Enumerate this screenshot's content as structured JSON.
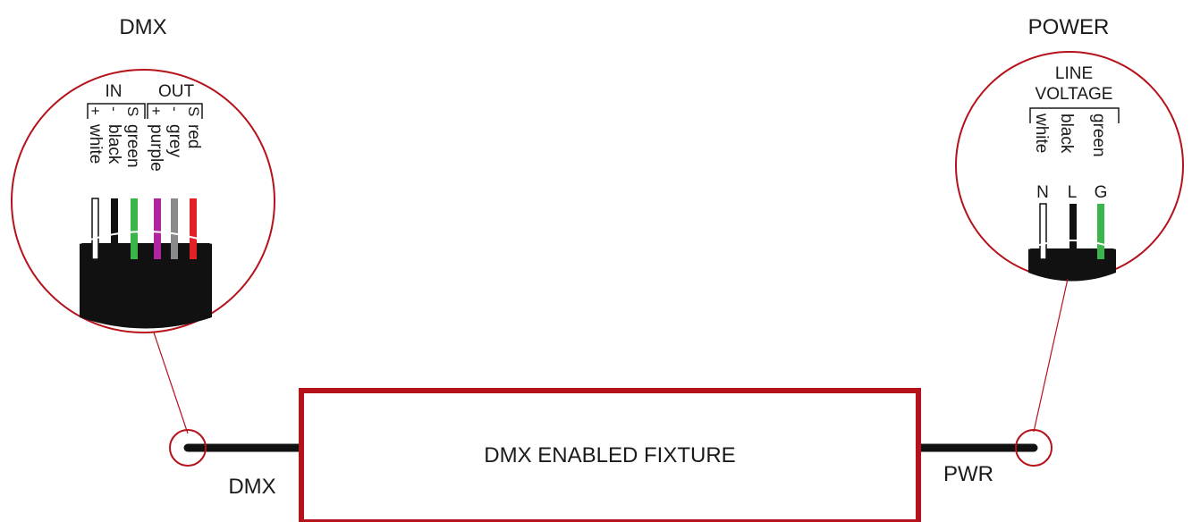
{
  "colors": {
    "accent_red": "#b5121b",
    "cable_black": "#111111",
    "wire_white": "#ffffff",
    "wire_black": "#111111",
    "wire_green": "#3ab54a",
    "wire_purple": "#b0249e",
    "wire_grey": "#8a8a8a",
    "wire_red": "#e22027"
  },
  "dmx": {
    "title": "DMX",
    "in_label": "IN",
    "out_label": "OUT",
    "in_pins": [
      "+",
      "-",
      "S"
    ],
    "out_pins": [
      "+",
      "-",
      "S"
    ],
    "in_wires": [
      "white",
      "black",
      "green"
    ],
    "out_wires": [
      "purple",
      "grey",
      "red"
    ],
    "cable_label": "DMX"
  },
  "power": {
    "title": "POWER",
    "line_label": "LINE",
    "voltage_label": "VOLTAGE",
    "wires": [
      "white",
      "black",
      "green"
    ],
    "terminals": [
      "N",
      "L",
      "G"
    ],
    "cable_label": "PWR"
  },
  "fixture": {
    "label": "DMX ENABLED FIXTURE"
  }
}
